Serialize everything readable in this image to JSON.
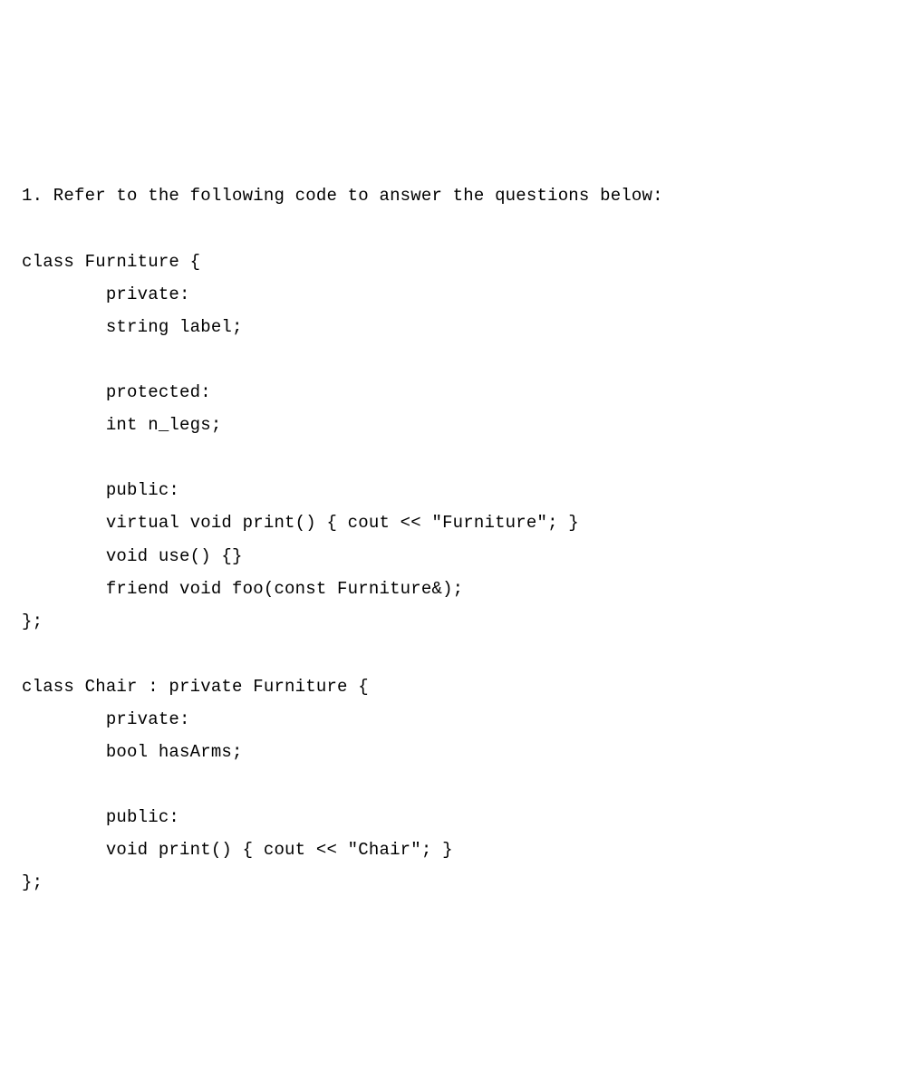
{
  "question_prompt": "1. Refer to the following code to answer the questions below:",
  "code_lines": [
    "class Furniture {",
    "        private:",
    "        string label;",
    "",
    "        protected:",
    "        int n_legs;",
    "",
    "        public:",
    "        virtual void print() { cout << \"Furniture\"; }",
    "        void use() {}",
    "        friend void foo(const Furniture&);",
    "};",
    "",
    "class Chair : private Furniture {",
    "        private:",
    "        bool hasArms;",
    "",
    "        public:",
    "        void print() { cout << \"Chair\"; }",
    "};"
  ]
}
